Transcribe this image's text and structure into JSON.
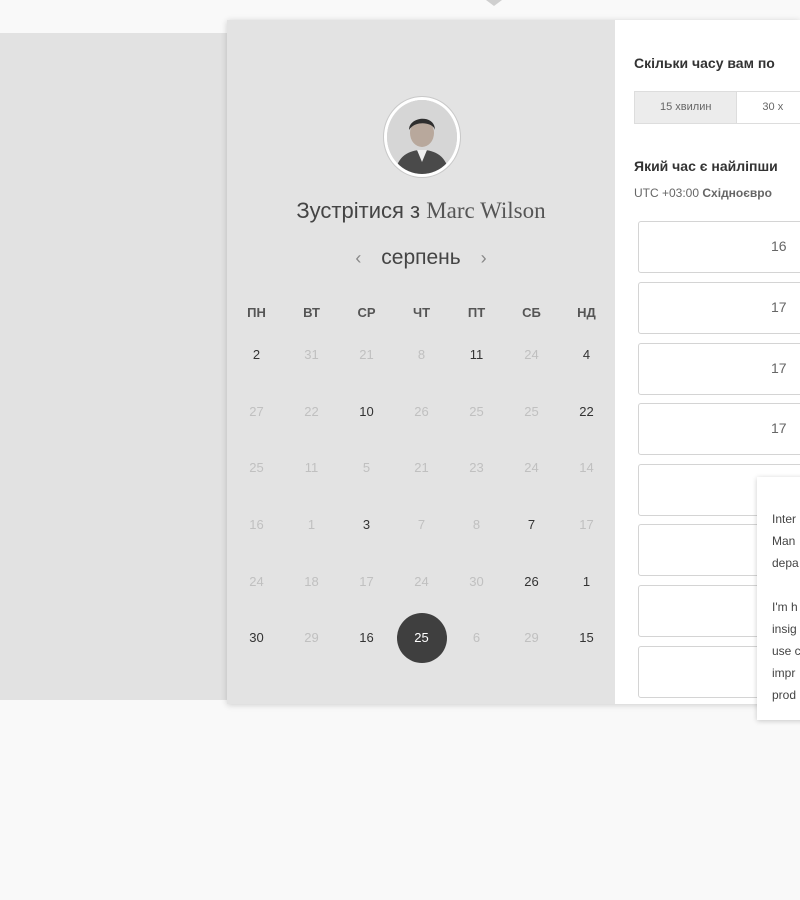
{
  "meeting": {
    "title_prefix": "Зустрітися з",
    "host_name": "Marc Wilson",
    "avatar_icon": "person-avatar"
  },
  "calendar": {
    "month": "серпень",
    "prev_icon": "‹",
    "next_icon": "›",
    "weekdays": [
      "ПН",
      "ВТ",
      "СР",
      "ЧТ",
      "ПТ",
      "СБ",
      "НД"
    ],
    "weeks": [
      [
        {
          "d": "2",
          "a": true
        },
        {
          "d": "31",
          "a": false
        },
        {
          "d": "21",
          "a": false
        },
        {
          "d": "8",
          "a": false
        },
        {
          "d": "11",
          "a": true
        },
        {
          "d": "24",
          "a": false
        },
        {
          "d": "4",
          "a": true
        }
      ],
      [
        {
          "d": "27",
          "a": false
        },
        {
          "d": "22",
          "a": false
        },
        {
          "d": "10",
          "a": true
        },
        {
          "d": "26",
          "a": false
        },
        {
          "d": "25",
          "a": false
        },
        {
          "d": "25",
          "a": false
        },
        {
          "d": "22",
          "a": true
        }
      ],
      [
        {
          "d": "25",
          "a": false
        },
        {
          "d": "11",
          "a": false
        },
        {
          "d": "5",
          "a": false
        },
        {
          "d": "21",
          "a": false
        },
        {
          "d": "23",
          "a": false
        },
        {
          "d": "24",
          "a": false
        },
        {
          "d": "14",
          "a": false
        }
      ],
      [
        {
          "d": "16",
          "a": false
        },
        {
          "d": "1",
          "a": false
        },
        {
          "d": "3",
          "a": true
        },
        {
          "d": "7",
          "a": false
        },
        {
          "d": "8",
          "a": false
        },
        {
          "d": "7",
          "a": true
        },
        {
          "d": "17",
          "a": false
        }
      ],
      [
        {
          "d": "24",
          "a": false
        },
        {
          "d": "18",
          "a": false
        },
        {
          "d": "17",
          "a": false
        },
        {
          "d": "24",
          "a": false
        },
        {
          "d": "30",
          "a": false
        },
        {
          "d": "26",
          "a": true
        },
        {
          "d": "1",
          "a": true
        }
      ],
      [
        {
          "d": "30",
          "a": true
        },
        {
          "d": "29",
          "a": false
        },
        {
          "d": "16",
          "a": true
        },
        {
          "d": "25",
          "a": true,
          "selected": true
        },
        {
          "d": "6",
          "a": false
        },
        {
          "d": "29",
          "a": false
        },
        {
          "d": "15",
          "a": true
        }
      ]
    ]
  },
  "booking": {
    "duration_question": "Скільки часу вам по",
    "durations": [
      {
        "label": "15 хвилин",
        "active": true
      },
      {
        "label": "30 х",
        "active": false
      }
    ],
    "time_question": "Який час є найліпши",
    "timezone_prefix": "UTC +03:00",
    "timezone_name": "Східноєвро",
    "slots": [
      "16",
      "17",
      "17",
      "17",
      "",
      "",
      ""
    ]
  },
  "bio": {
    "lines": [
      "Inter",
      "Man",
      "depa",
      "",
      "I'm h",
      "insig",
      "use c",
      "impr",
      "prod"
    ]
  }
}
